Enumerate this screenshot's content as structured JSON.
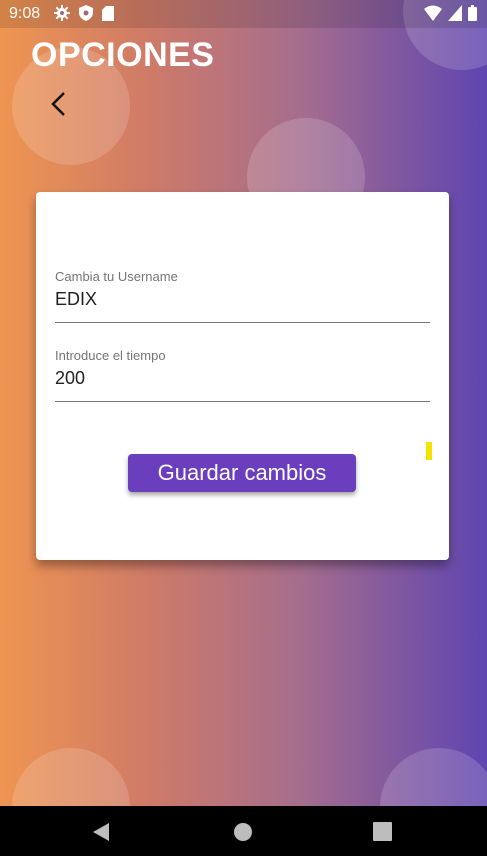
{
  "status_bar": {
    "time": "9:08",
    "icons": [
      "gear-icon",
      "shield-icon",
      "sd-card-icon",
      "wifi-icon",
      "signal-icon",
      "battery-icon"
    ]
  },
  "header": {
    "title": "OPCIONES",
    "back_icon": "chevron-left-icon"
  },
  "form": {
    "username": {
      "label": "Cambia tu Username",
      "value": "EDIX"
    },
    "time": {
      "label": "Introduce el tiempo",
      "value": "200"
    },
    "save_label": "Guardar cambios"
  },
  "nav_bar": {
    "buttons": [
      "back-triangle-icon",
      "home-circle-icon",
      "recents-square-icon"
    ]
  },
  "colors": {
    "gradient_start": "#ef9551",
    "gradient_end": "#5f45b0",
    "button": "#6a3ebd",
    "marker": "#f5e400"
  }
}
